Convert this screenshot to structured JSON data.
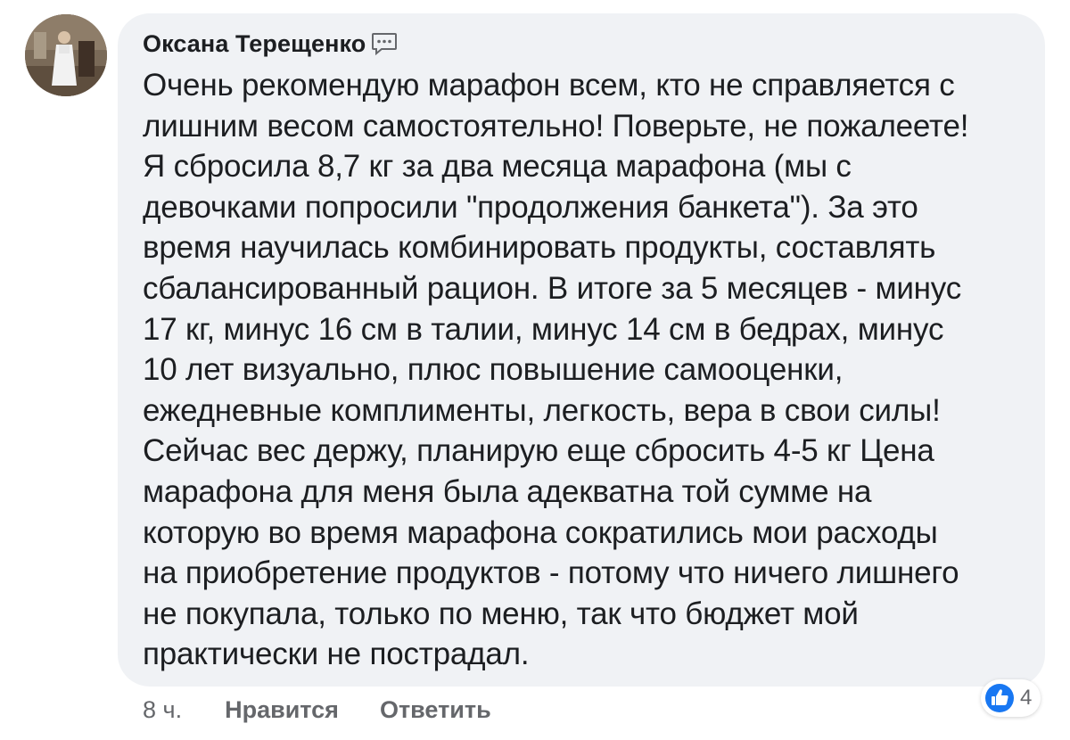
{
  "comment": {
    "author": "Оксана Терещенко",
    "author_icon": "messenger-bubble-icon",
    "avatar_icon": "profile-photo-avatar",
    "text": "Очень рекомендую марафон всем, кто не справляется с\nлишним весом самостоятельно! Поверьте, не пожалеете!\nЯ сбросила 8,7 кг за два месяца марафона (мы с\nдевочками попросили \"продолжения банкета\"). За это\nвремя научилась комбинировать продукты, составлять\nсбалансированный рацион. В итоге за 5 месяцев - минус\n17 кг, минус 16 см в талии, минус 14 см в бедрах, минус\n10 лет визуально, плюс повышение самооценки,\nежедневные комплименты, легкость, вера в свои силы!\nСейчас вес держу, планирую еще сбросить 4-5 кг Цена\nмарафона для меня была адекватна той сумме на\nкоторую во время марафона сократились мои расходы\nна приобретение продуктов - потому что ничего лишнего\nне покупала, только по меню, так что бюджет мой\nпрактически не пострадал.",
    "time": "8 ч.",
    "like_label": "Нравится",
    "reply_label": "Ответить",
    "reactions": {
      "icon": "thumbs-up-icon",
      "count": "4"
    }
  },
  "colors": {
    "bubble_bg": "#f0f2f5",
    "text": "#1c1e21",
    "secondary": "#65676b",
    "like_blue": "#1877f2"
  }
}
